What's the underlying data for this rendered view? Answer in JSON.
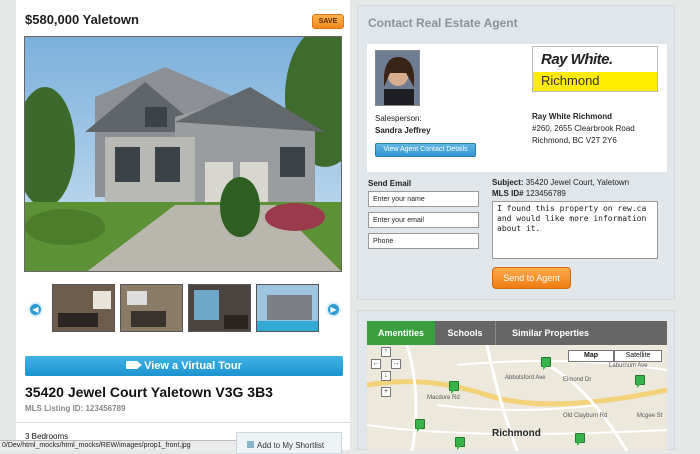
{
  "listing": {
    "price": "$580,000",
    "area": "Yaletown",
    "save_label": "SAVE",
    "tour_label": "View a Virtual Tour",
    "address": "35420 Jewel Court Yaletown V3G 3B3",
    "mls_listing": "MLS Listing ID: 123456789",
    "bedrooms": "3 Bedrooms",
    "shortlist_label": "Add to My Shortlist",
    "prev_icon": "left-arrow-icon",
    "next_icon": "right-arrow-icon"
  },
  "statusbar": {
    "url": "0/Dev/html_mocks/html_mocks/REW/images/prop1_front.jpg"
  },
  "contact": {
    "heading": "Contact Real Estate Agent",
    "salesperson_label": "Salesperson:",
    "salesperson_name": "Sandra Jeffrey",
    "view_details": "View Agent Contact Details",
    "logo_brand": "Ray White.",
    "logo_office": "Richmond",
    "brokerage_name": "Ray White Richmond",
    "brokerage_addr1": "#260, 2655 Clearbrook Road",
    "brokerage_addr2": "Richmond, BC V2T 2Y6",
    "send_email_label": "Send Email",
    "name_placeholder": "Enter your name",
    "email_placeholder": "Enter your email",
    "phone_placeholder": "Phone",
    "subject_label": "Subject:",
    "subject_value": "35420 Jewel Court, Yaletown",
    "mls_label": "MLS ID#",
    "mls_value": "123456789",
    "message": "I found this property on rew.ca and would like more information about it.",
    "send_label": "Send to Agent"
  },
  "map_panel": {
    "tabs": [
      "Amentities",
      "Schools",
      "Similar Properties"
    ],
    "map_btn": "Map",
    "satellite_btn": "Satellite",
    "place": "Richmond",
    "streets": [
      "Macdure Rd",
      "Abbotsford Ave",
      "Elmond Dr",
      "Laburnum Ave",
      "Old Clayburn Rd",
      "Mcgee St"
    ]
  },
  "colors": {
    "accent_orange": "#f08a1c",
    "accent_blue": "#2d9bd4",
    "tab_green": "#3a9e3f",
    "logo_yellow": "#ffec00"
  }
}
